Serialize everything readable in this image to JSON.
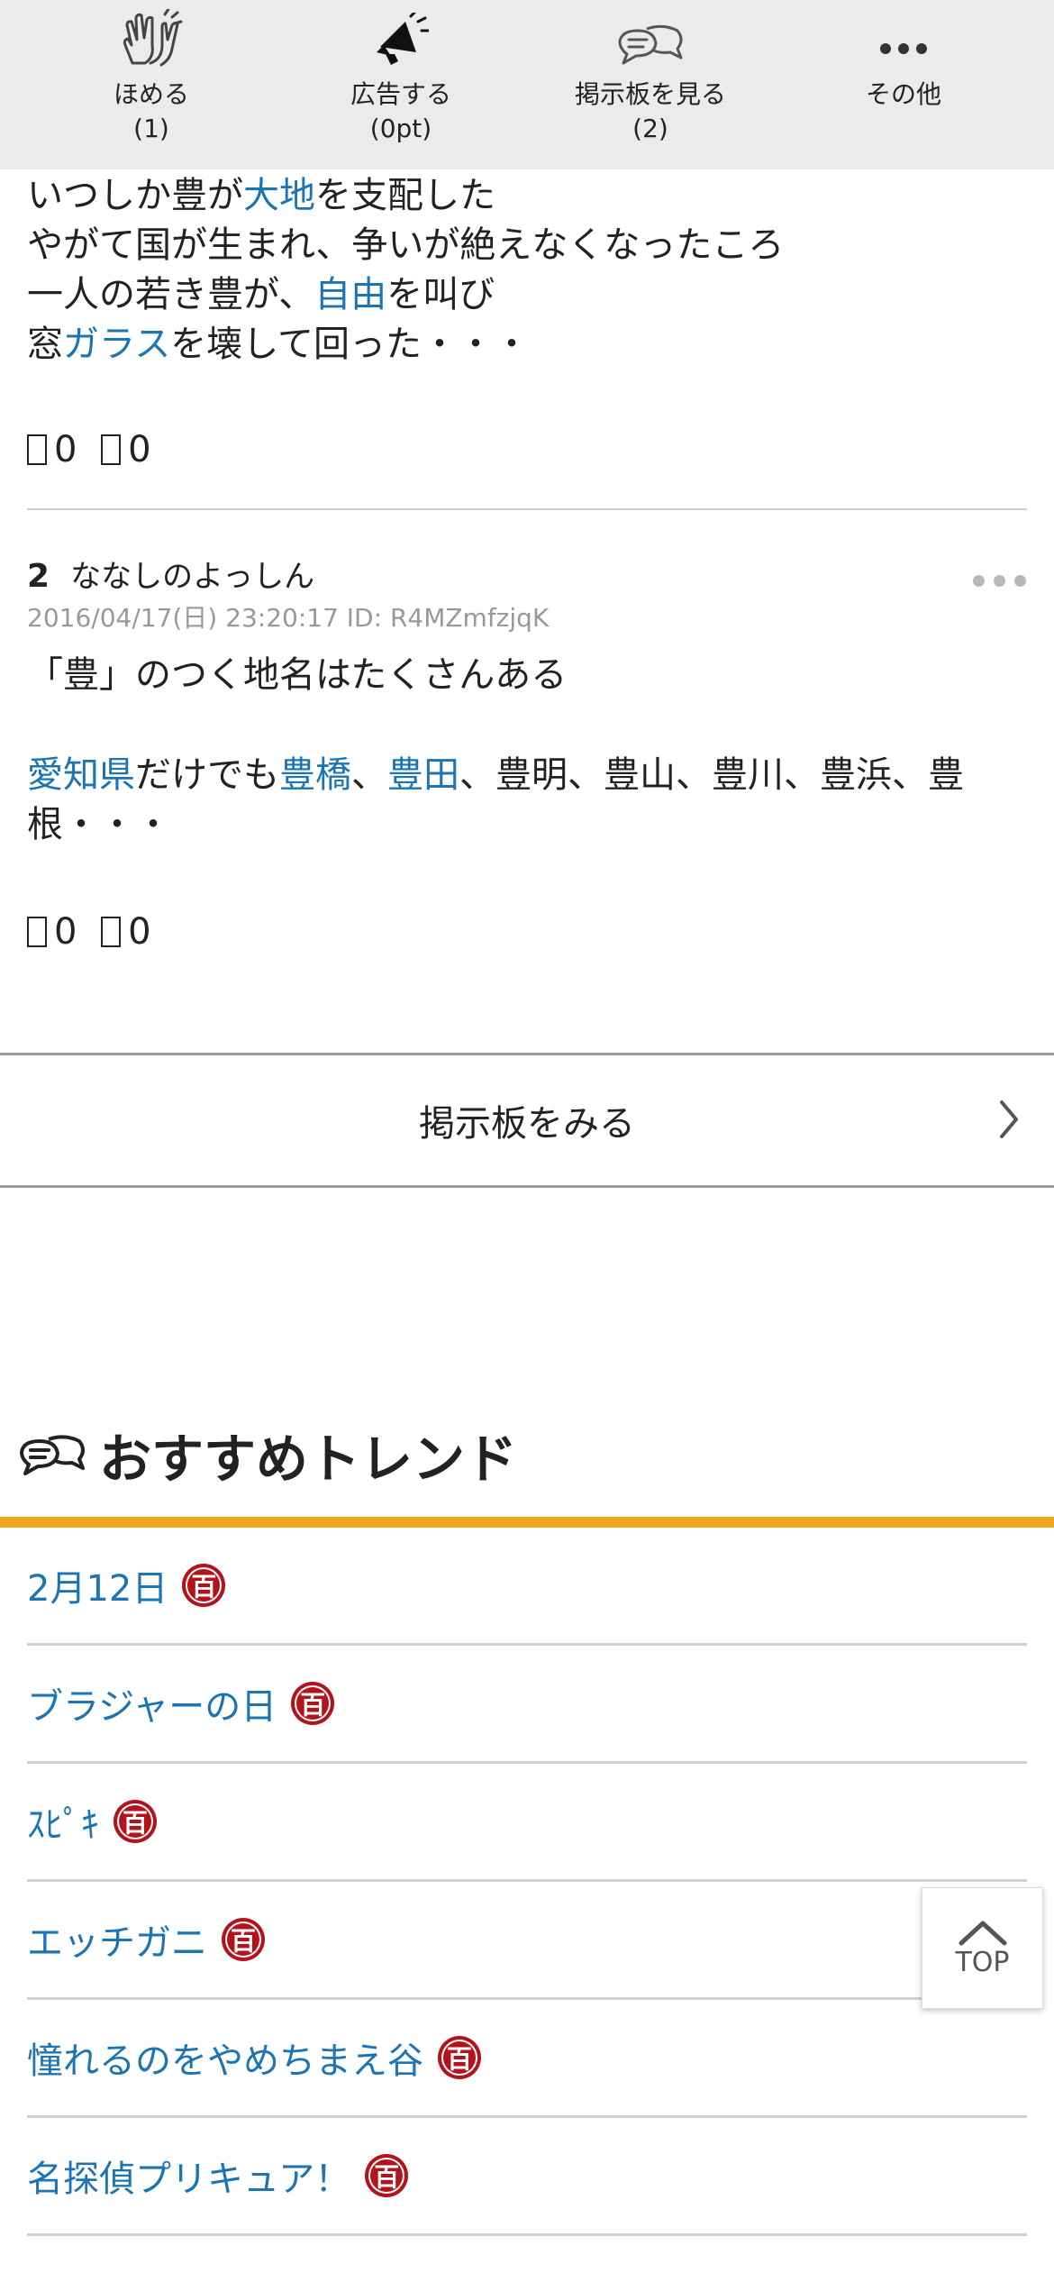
{
  "toolbar": [
    {
      "label": "ほめる",
      "sub": "(1)",
      "icon": "clap-icon"
    },
    {
      "label": "広告する",
      "sub": "(0pt)",
      "icon": "megaphone-icon"
    },
    {
      "label": "掲示板を見る",
      "sub": "(2)",
      "icon": "speech-bubbles-icon"
    },
    {
      "label": "その他",
      "sub": "",
      "icon": "more-dots-icon"
    }
  ],
  "post1": {
    "lines": [
      [
        "いつしか豊が",
        "大地",
        "を支配した"
      ],
      [
        "やがて国が生まれ、争いが絶えなくなったころ"
      ],
      [
        "一人の若き豊が、",
        "自由",
        "を叫び"
      ],
      [
        "窓",
        "ガラス",
        "を壊して回った・・・"
      ]
    ],
    "good": "0",
    "bad": "0"
  },
  "post2": {
    "number": "2",
    "name": "ななしのよっしん",
    "meta": "2016/04/17(日) 23:20:17 ID: R4MZmfzjqK",
    "line1": "「豊」のつく地名はたくさんある",
    "line2_parts": [
      "愛知県",
      "だけでも",
      "豊橋",
      "、",
      "豊田",
      "、豊明、豊山、豊川、豊浜、豊"
    ],
    "line3": "根・・・",
    "good": "0",
    "bad": "0"
  },
  "board_link_label": "掲示板をみる",
  "trend": {
    "title": "おすすめトレンド",
    "badge": "百",
    "items": [
      "2月12日",
      "ブラジャーの日",
      "ｽﾋﾟｷ",
      "エッチガニ",
      "憧れるのをやめちまえ谷",
      "名探偵プリキュア！"
    ]
  },
  "top_button_label": "TOP",
  "colors": {
    "link": "#1b74b3",
    "accent": "#f2a81e",
    "badge": "#b3141c",
    "toolbar_bg": "#ebebeb"
  }
}
